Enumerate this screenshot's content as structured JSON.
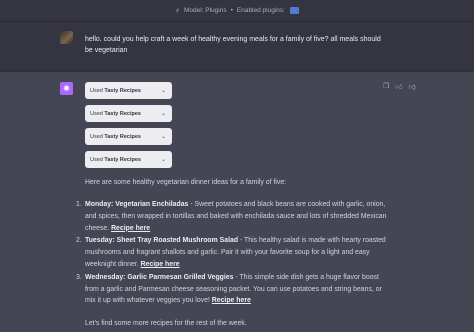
{
  "topbar": {
    "model_label": "Model: Plugins",
    "separator": "•",
    "enabled_label": "Enabled plugins:"
  },
  "user_message": {
    "text": "hello. could you help craft a week of healthy evening meals for a family of five? all meals should be vegetarian"
  },
  "assistant": {
    "plugin_calls": [
      {
        "prefix": "Used",
        "name": "Tasty Recipes"
      },
      {
        "prefix": "Used",
        "name": "Tasty Recipes"
      },
      {
        "prefix": "Used",
        "name": "Tasty Recipes"
      },
      {
        "prefix": "Used",
        "name": "Tasty Recipes"
      }
    ],
    "intro": "Here are some healthy vegetarian dinner ideas for a family of five:",
    "meals": [
      {
        "number": "1.",
        "title": "Monday: Vegetarian Enchiladas",
        "description": " - Sweet potatoes and black beans are cooked with garlic, onion, and spices, then wrapped in tortillas and baked with enchilada sauce and lots of shredded Mexican cheese. ",
        "link": "Recipe here"
      },
      {
        "number": "2.",
        "title": "Tuesday: Sheet Tray Roasted Mushroom Salad",
        "description": " - This healthy salad is made with hearty roasted mushrooms and fragrant shallots and garlic. Pair it with your favorite soup for a light and easy weeknight dinner. ",
        "link": "Recipe here"
      },
      {
        "number": "3.",
        "title": "Wednesday: Garlic Parmesan Grilled Veggies",
        "description": " - This simple side dish gets a huge flavor boost from a garlic and Parmesan cheese seasoning packet. You can use potatoes and string beans, or mix it up with whatever veggies you love! ",
        "link": "Recipe here"
      }
    ],
    "outro": "Let's find some more recipes for the rest of the week."
  },
  "icons": {
    "plug": "plug-icon",
    "copy": "copy-icon",
    "thumbs_up": "thumbs-up-icon",
    "thumbs_down": "thumbs-down-icon",
    "chevron": "chevron-down-icon"
  },
  "colors": {
    "user_bg": "#343541",
    "assistant_bg": "#444654",
    "gpt_avatar": "#ab68ff",
    "plugin_pill_bg": "#ececf1"
  }
}
